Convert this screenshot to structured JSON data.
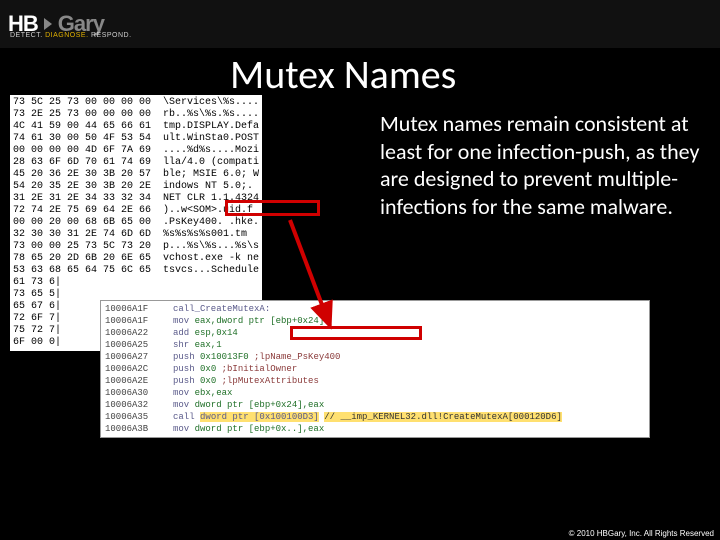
{
  "logo": {
    "hb": "HB",
    "gary": "Gary"
  },
  "tagline": {
    "detect": "DETECT.",
    "diagnose": "DIAGNOSE.",
    "respond": "RESPOND."
  },
  "title": "Mutex Names",
  "body": "Mutex names remain consistent at least for one infection-push, as they are designed to prevent multiple-infections for the same malware.",
  "footer": "© 2010 HBGary, Inc. All Rights Reserved",
  "hex": "73 5C 25 73 00 00 00 00  \\Services\\%s....\n73 2E 25 73 00 00 00 00  rb..%s\\%s.%s....\n4C 41 59 00 44 65 66 61  tmp.DISPLAY.Defa\n74 61 30 00 50 4F 53 54  ult.WinSta0.POST\n00 00 00 00 4D 6F 7A 69  ....%d%s....Mozi\n28 63 6F 6D 70 61 74 69  lla/4.0 (compati\n45 20 36 2E 30 3B 20 57  ble; MSIE 6.0; W\n54 20 35 2E 30 3B 20 2E  indows NT 5.0;.\n31 2E 31 2E 34 33 32 34  NET CLR 1.1.4324\n72 74 2E 75 69 64 2E 66  )..w<SOM>.uid.f\n00 00 20 00 68 6B 65 00  .PsKey400. .hke.\n32 30 30 31 2E 74 6D 6D  %s%s%s%s001.tm\n73 00 00 25 73 5C 73 20  p...%s\\%s...%s\\s\n78 65 20 2D 6B 20 6E 65  vchost.exe -k ne\n53 63 68 65 64 75 6C 65  tsvcs...Schedule\n61 73 6|\n73 65 5|\n65 67 6|\n72 6F 7|\n75 72 7|\n6F 00 0|",
  "asm": [
    {
      "addr": "10006A1F",
      "label": "call_CreateMutexA:"
    },
    {
      "addr": "10006A1F",
      "op": "mov",
      "args": "eax,dword ptr [ebp+0x24]"
    },
    {
      "addr": "10006A22",
      "op": "add",
      "args": "esp,0x14"
    },
    {
      "addr": "10006A25",
      "op": "shr",
      "args": "eax,1"
    },
    {
      "addr": "10006A27",
      "op": "push",
      "args": "0x10013F0",
      "cmt": ";lpName_PsKey400"
    },
    {
      "addr": "10006A2C",
      "op": "push",
      "args": "0x0",
      "cmt": ";bInitialOwner"
    },
    {
      "addr": "10006A2E",
      "op": "push",
      "args": "0x0",
      "cmt": ";lpMutexAttributes"
    },
    {
      "addr": "10006A30",
      "op": "mov",
      "args": "ebx,eax"
    },
    {
      "addr": "10006A32",
      "op": "mov",
      "args": "dword ptr [ebp+0x24],eax"
    },
    {
      "addr": "10006A35",
      "op": "call",
      "args": "dword ptr [0x100100D3]",
      "cmt": "// __imp_KERNEL32.dll!CreateMutexA[000120D6]",
      "hl": true
    },
    {
      "addr": "10006A3B",
      "op": "mov",
      "args": "dword ptr [ebp+0x..],eax"
    }
  ]
}
